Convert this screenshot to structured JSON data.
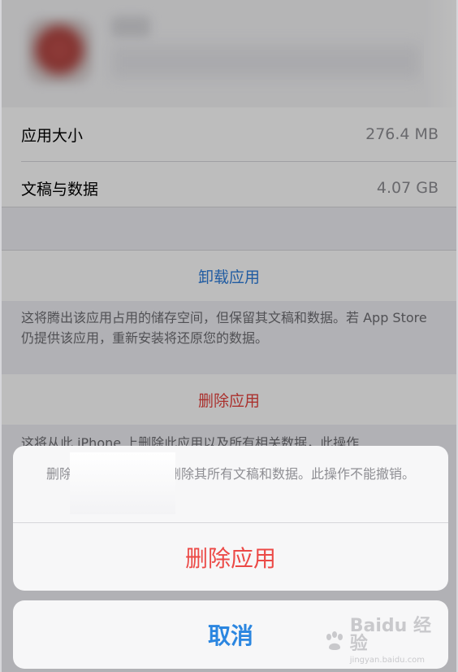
{
  "storage": {
    "rows": [
      {
        "label": "应用大小",
        "value": "276.4 MB"
      },
      {
        "label": "文稿与数据",
        "value": "4.07 GB"
      }
    ]
  },
  "offload": {
    "button_label": "卸载应用",
    "note": "这将腾出该应用占用的储存空间，但保留其文稿和数据。若 App Store 仍提供该应用，重新安装将还原您的数据。"
  },
  "delete": {
    "button_label": "删除应用",
    "note": "这将从此 iPhone 上删除此应用以及所有相关数据，此操作"
  },
  "action_sheet": {
    "message_part1": "删除",
    "message_part2": "删除其所有文稿和数据。此操作不能撤销。",
    "delete_label": "删除应用",
    "cancel_label": "取消"
  },
  "watermark": {
    "main_text": "Baidu 经验",
    "sub_text": "jingyan.baidu.com"
  },
  "colors": {
    "link_blue": "#2d7ddb",
    "destructive_red": "#e6433e",
    "secondary_text": "#8e8e93"
  }
}
